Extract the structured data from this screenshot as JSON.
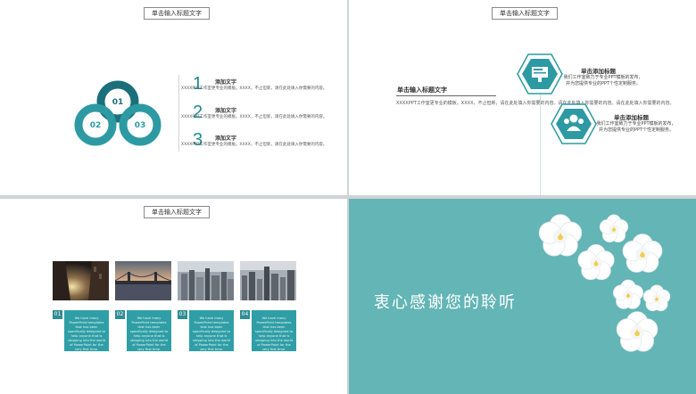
{
  "slide1": {
    "title": "单击输入标题文字",
    "rings": [
      "01",
      "02",
      "03"
    ],
    "items": [
      {
        "num": "1",
        "label": "添加文字",
        "text": "XXXXPPT工作室更专业的模板。XXXX，不止但新，请在此处填入你需要的内容。"
      },
      {
        "num": "2",
        "label": "添加文字",
        "text": "XXXXPPT工作室更专业的模板。XXXX，不止但新，请在此处填入你需要的内容。"
      },
      {
        "num": "3",
        "label": "添加文字",
        "text": "XXXXPPT工作室更专业的模板。XXXX，不止但新，请在此处填入你需要的内容。"
      }
    ]
  },
  "slide2": {
    "title": "单击输入标题文字",
    "heading": "单击输入标题文字",
    "body": "XXXXPPT工作室更专业的模板。XXXX，不止但新，请在此处填入你需要的内容。请在此处填入你需要的内容。请在此处填入你需要的内容。",
    "blocks": [
      {
        "heading": "单击添加标题",
        "text": "我们工作室致力于专业PPT模板的发布，并为您提供专业的PPT个性定制服务。",
        "icon": "presentation-icon"
      },
      {
        "heading": "单击添加标题",
        "text": "我们工作室致力于专业PPT模板的发布，并为您提供专业的PPT个性定制服务。",
        "icon": "team-icon"
      }
    ]
  },
  "slide3": {
    "title": "单击输入标题文字",
    "cards": [
      {
        "num": "01",
        "text": "We have many PowerPoint templates that has been specifically designed to help anyone that is stepping into the world of PowerPoint for the very first time."
      },
      {
        "num": "02",
        "text": "We have many PowerPoint templates that has been specifically designed to help anyone that is stepping into the world of PowerPoint for the very first time."
      },
      {
        "num": "03",
        "text": "We have many PowerPoint templates that has been specifically designed to help anyone that is stepping into the world of PowerPoint for the very first time."
      },
      {
        "num": "04",
        "text": "We have many PowerPoint templates that has been specifically designed to help anyone that is stepping into the world of PowerPoint for the very first time."
      }
    ]
  },
  "slide4": {
    "thanks": "衷心感谢您的聆听",
    "background": "#63b5b6"
  },
  "colors": {
    "teal": "#1f8a93",
    "teal_light": "#2f9ea6"
  }
}
